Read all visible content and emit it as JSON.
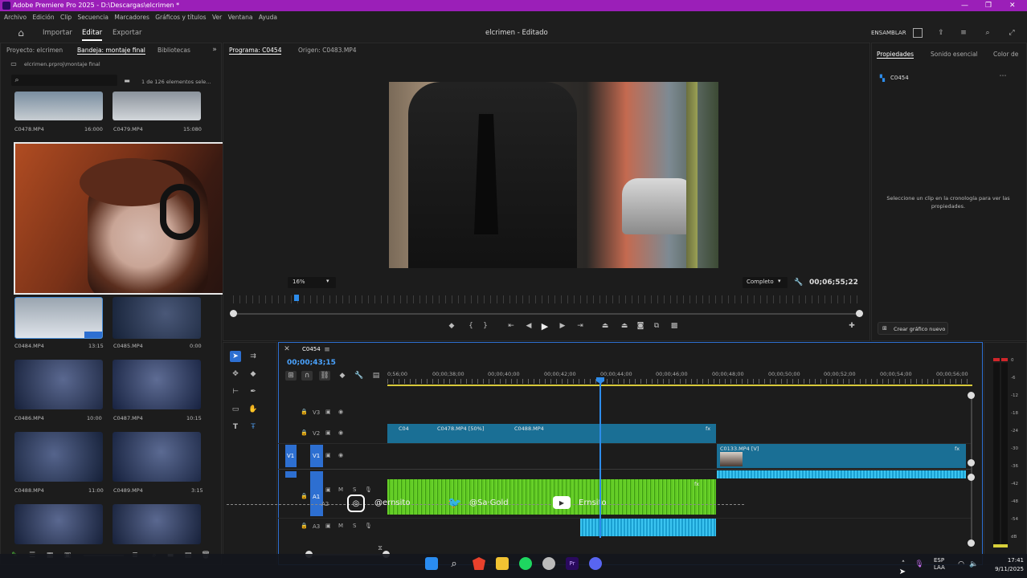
{
  "window": {
    "title": "Adobe Premiere Pro 2025 - D:\\Descargas\\elcrimen *"
  },
  "menu": [
    "Archivo",
    "Edición",
    "Clip",
    "Secuencia",
    "Marcadores",
    "Gráficos y títulos",
    "Ver",
    "Ventana",
    "Ayuda"
  ],
  "workspace": {
    "tabs": [
      "Importar",
      "Editar",
      "Exportar"
    ],
    "active": "Editar",
    "project_title": "elcrimen - Editado",
    "ensamblar": "ENSAMBLAR"
  },
  "project_panel": {
    "tabs": [
      "Proyecto: elcrimen",
      "Bandeja: montaje final",
      "Bibliotecas"
    ],
    "breadcrumb": "elcrimen.prproj\\montaje final",
    "count": "1 de 126 elementos sele...",
    "clips": [
      {
        "name": "C0478.MP4",
        "dur": "16:000"
      },
      {
        "name": "C0479.MP4",
        "dur": "15:080"
      },
      {
        "name": "C0484.MP4",
        "dur": "13:15"
      },
      {
        "name": "C0485.MP4",
        "dur": "0:00"
      },
      {
        "name": "C0486.MP4",
        "dur": "10:00"
      },
      {
        "name": "C0487.MP4",
        "dur": "10:15"
      },
      {
        "name": "C0488.MP4",
        "dur": "11:00"
      },
      {
        "name": "C0489.MP4",
        "dur": "3:15"
      }
    ]
  },
  "program": {
    "tabs": [
      "Programa: C0454",
      "Origen: C0483.MP4"
    ],
    "zoom": "16%",
    "quality": "Completo",
    "timecode": "00;06;55;22"
  },
  "properties": {
    "tabs": [
      "Propiedades",
      "Sonido esencial",
      "Color de"
    ],
    "clip_name": "C0454",
    "hint": "Seleccione un clip en la cronología para ver las propiedades.",
    "new_graphic": "Crear gráfico nuevo"
  },
  "timeline": {
    "sequence": "C0454",
    "timecode": "00;00;43;15",
    "ruler": [
      "0;56;00",
      "00;00;38;00",
      "00;00;40;00",
      "00;00;42;00",
      "00;00;44;00",
      "00;00;46;00",
      "00;00;48;00",
      "00;00;50;00",
      "00;00;52;00",
      "00;00;54;00",
      "00;00;56;00"
    ],
    "tracks": [
      "V3",
      "V2",
      "V1",
      "A1",
      "A2",
      "A3"
    ],
    "clips": {
      "v2a": "C04",
      "v2b": "C0478.MP4 [50%]",
      "v2c": "C0488.MP4",
      "v1": "C0133.MP4 [V]"
    },
    "overlay": [
      "@ernsito",
      "@Sa·Gold",
      "Ernsito"
    ],
    "meter": [
      "0",
      "-6",
      "-12",
      "-18",
      "-24",
      "-30",
      "-36",
      "-42",
      "-48",
      "-54",
      "dB"
    ]
  },
  "taskbar": {
    "lang": "ESP\nLAA",
    "time": "17:41",
    "date": "9/11/2025"
  },
  "colors": {
    "accent": "#2d8ceb",
    "title_bar": "#9b1fb8",
    "video_clip": "#1a6f95",
    "audio_clip": "#52b81c",
    "playhead": "#2d8ceb"
  }
}
